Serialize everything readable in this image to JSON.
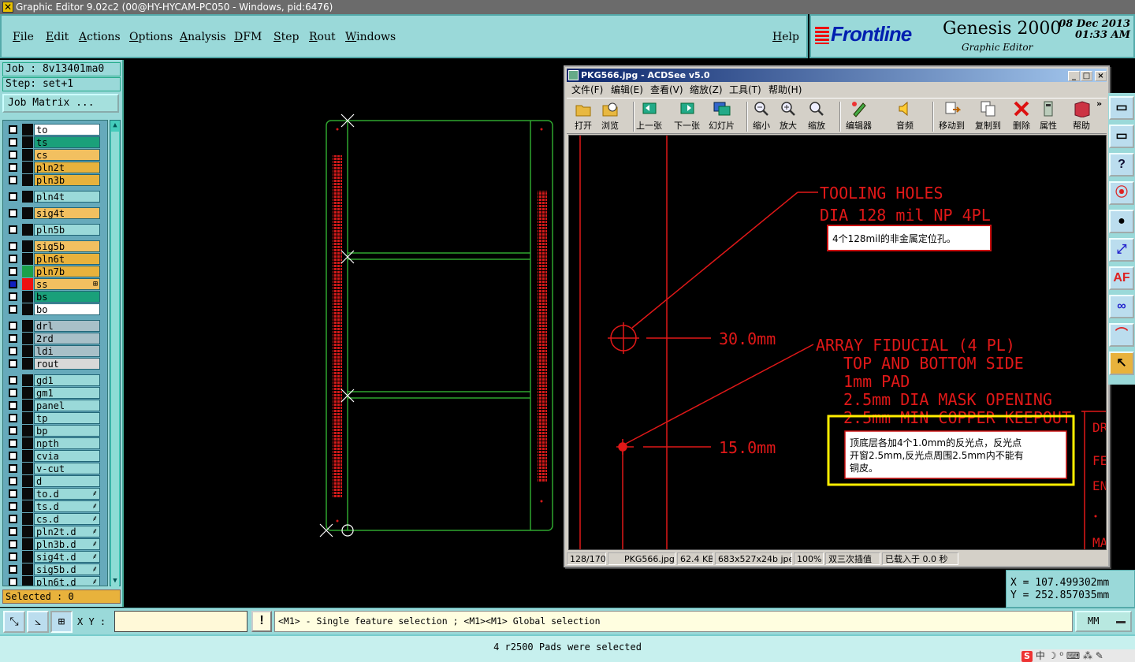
{
  "titlebar": {
    "title": "Graphic Editor 9.02c2 (00@HY-HYCAM-PC050 - Windows, pid:6476)"
  },
  "menu": {
    "items": [
      "File",
      "Edit",
      "Actions",
      "Options",
      "Analysis",
      "DFM",
      "Step",
      "Rout",
      "Windows"
    ],
    "help": "Help"
  },
  "brand": {
    "logo": "Frontline",
    "product": "Genesis 2000",
    "subtitle": "Graphic Editor",
    "date": "08 Dec 2013",
    "time": "01:33 AM"
  },
  "left": {
    "job": "Job : 8v13401ma0",
    "step": "Step: set+1",
    "job_matrix": "Job Matrix ...",
    "selected": "Selected : 0"
  },
  "layers": [
    {
      "name": "to",
      "color": "#ffffff",
      "swatch": "#0a0a0a",
      "box": "#ffffff"
    },
    {
      "name": "ts",
      "color": "#1aa07a",
      "swatch": "#0a0a0a",
      "box": "#ffffff"
    },
    {
      "name": "cs",
      "color": "#f2c060",
      "swatch": "#0a0a0a",
      "box": "#ffffff"
    },
    {
      "name": "pln2t",
      "color": "#e8b23c",
      "swatch": "#0a0a0a",
      "box": "#ffffff"
    },
    {
      "name": "pln3b",
      "color": "#e8b23c",
      "swatch": "#0a0a0a",
      "box": "#ffffff"
    },
    {
      "name": "pln4t",
      "color": "#9ad9d9",
      "swatch": "#0a0a0a",
      "box": "#ffffff"
    },
    {
      "name": "sig4t",
      "color": "#f2c060",
      "swatch": "#0a0a0a",
      "box": "#ffffff"
    },
    {
      "name": "pln5b",
      "color": "#9ad9d9",
      "swatch": "#0a0a0a",
      "box": "#ffffff"
    },
    {
      "name": "sig5b",
      "color": "#f2c060",
      "swatch": "#0a0a0a",
      "box": "#ffffff"
    },
    {
      "name": "pln6t",
      "color": "#e8b23c",
      "swatch": "#0a0a0a",
      "box": "#ffffff"
    },
    {
      "name": "pln7b",
      "color": "#e8b23c",
      "swatch": "#1aa04a",
      "box": "#ffffff"
    },
    {
      "name": "ss",
      "color": "#f2c060",
      "swatch": "#ee1111",
      "box": "#1020c0",
      "mark": "⊞"
    },
    {
      "name": "bs",
      "color": "#1aa07a",
      "swatch": "#0a0a0a",
      "box": "#ffffff"
    },
    {
      "name": "bo",
      "color": "#ffffff",
      "swatch": "#0a0a0a",
      "box": "#ffffff"
    },
    {
      "name": "drl",
      "color": "#a8c0c8",
      "swatch": "#0a0a0a",
      "box": "#ffffff"
    },
    {
      "name": "2rd",
      "color": "#a8c0c8",
      "swatch": "#0a0a0a",
      "box": "#ffffff"
    },
    {
      "name": "ldi",
      "color": "#a8c0c8",
      "swatch": "#0a0a0a",
      "box": "#ffffff"
    },
    {
      "name": "rout",
      "color": "#d8d8d8",
      "swatch": "#0a0a0a",
      "box": "#ffffff"
    },
    {
      "name": "gd1",
      "color": "#9ad9d9",
      "swatch": "#0a0a0a",
      "box": "#ffffff"
    },
    {
      "name": "gm1",
      "color": "#9ad9d9",
      "swatch": "#0a0a0a",
      "box": "#ffffff"
    },
    {
      "name": "panel",
      "color": "#9ad9d9",
      "swatch": "#0a0a0a",
      "box": "#ffffff"
    },
    {
      "name": "tp",
      "color": "#9ad9d9",
      "swatch": "#0a0a0a",
      "box": "#ffffff"
    },
    {
      "name": "bp",
      "color": "#9ad9d9",
      "swatch": "#0a0a0a",
      "box": "#ffffff"
    },
    {
      "name": "npth",
      "color": "#9ad9d9",
      "swatch": "#0a0a0a",
      "box": "#ffffff"
    },
    {
      "name": "cvia",
      "color": "#9ad9d9",
      "swatch": "#0a0a0a",
      "box": "#ffffff"
    },
    {
      "name": "v-cut",
      "color": "#9ad9d9",
      "swatch": "#0a0a0a",
      "box": "#ffffff"
    },
    {
      "name": "d",
      "color": "#9ad9d9",
      "swatch": "#0a0a0a",
      "box": "#ffffff"
    },
    {
      "name": "to.d",
      "color": "#9ad9d9",
      "swatch": "#0a0a0a",
      "box": "#ffffff",
      "mark": "⸙"
    },
    {
      "name": "ts.d",
      "color": "#9ad9d9",
      "swatch": "#0a0a0a",
      "box": "#ffffff",
      "mark": "⸙"
    },
    {
      "name": "cs.d",
      "color": "#9ad9d9",
      "swatch": "#0a0a0a",
      "box": "#ffffff",
      "mark": "⸙"
    },
    {
      "name": "pln2t.d",
      "color": "#9ad9d9",
      "swatch": "#0a0a0a",
      "box": "#ffffff",
      "mark": "⸙"
    },
    {
      "name": "pln3b.d",
      "color": "#9ad9d9",
      "swatch": "#0a0a0a",
      "box": "#ffffff",
      "mark": "⸙"
    },
    {
      "name": "sig4t.d",
      "color": "#9ad9d9",
      "swatch": "#0a0a0a",
      "box": "#ffffff",
      "mark": "⸙"
    },
    {
      "name": "sig5b.d",
      "color": "#9ad9d9",
      "swatch": "#0a0a0a",
      "box": "#ffffff",
      "mark": "⸙"
    },
    {
      "name": "pln6t.d",
      "color": "#9ad9d9",
      "swatch": "#0a0a0a",
      "box": "#ffffff",
      "mark": "⸙"
    }
  ],
  "right_tools": [
    "rect-outline-icon",
    "rect-outline-icon",
    "help-icon",
    "traffic-light-icon",
    "dot-icon",
    "move-icon",
    "af-icon",
    "link-icon",
    "arc-icon",
    "cursor-icon"
  ],
  "right_tool_labels": {
    "help": "?",
    "af": "AF"
  },
  "coords": {
    "x": "X = 107.499302mm",
    "y": "Y = 252.857035mm"
  },
  "bottom": {
    "xy_label": "X Y :",
    "xy_value": "",
    "info": "!",
    "hint": "<M1> - Single feature selection ; <M1><M1> Global selection",
    "unit": "MM"
  },
  "status": {
    "message": "4 r2500 Pads were selected"
  },
  "tray": {
    "text": "中 ☽ ⁰ ⌨ ⁂ ✎"
  },
  "acdsee": {
    "title": "PKG566.jpg - ACDSee v5.0",
    "menu": [
      "文件(F)",
      "编辑(E)",
      "查看(V)",
      "缩放(Z)",
      "工具(T)",
      "帮助(H)"
    ],
    "toolbar": [
      "打开",
      "浏览",
      "上一张",
      "下一张",
      "幻灯片",
      "缩小",
      "放大",
      "缩放",
      "编辑器",
      "音频",
      "移动到",
      "复制到",
      "删除",
      "属性",
      "帮助"
    ],
    "more": "»",
    "status": [
      "128/170",
      "PKG566.jpg",
      "62.4 KB",
      "683x527x24b jpeg",
      "100%",
      "双三次插值",
      "已载入于 0.0 秒"
    ],
    "image": {
      "tooling1": "TOOLING HOLES",
      "tooling2": "DIA 128 mil NP 4PL",
      "note1": "4个128mil的非金属定位孔。",
      "dim1": "30.0mm",
      "dim2": "15.0mm",
      "fid1": "ARRAY FIDUCIAL  (4 PL)",
      "fid2": "TOP AND BOTTOM SIDE",
      "fid3": "1mm PAD",
      "fid4": "2.5mm DIA MASK OPENING",
      "fid5": "2.5mm MIN COPPER KEEPOUT",
      "note2a": "顶底层各加4个1.0mm的反光点，反光点",
      "note2b": "开窗2.5mm,反光点周围2.5mm内不能有",
      "note2c": "铜皮。",
      "edge1": "DR",
      "edge2": "FE",
      "edge3": "EN",
      "edge4": "MA"
    }
  }
}
